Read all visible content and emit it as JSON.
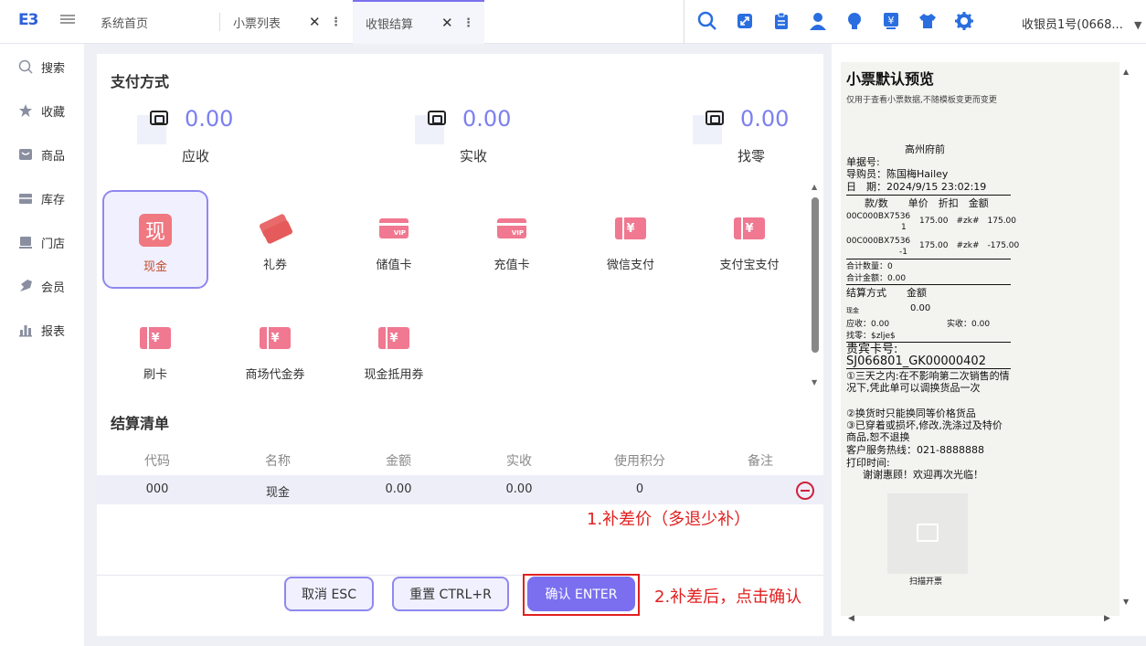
{
  "header": {
    "logo": "E3",
    "tabs": [
      {
        "label": "系统首页"
      },
      {
        "label": "小票列表",
        "close": "✕",
        "more": "⋮"
      },
      {
        "label": "收银结算",
        "close": "✕",
        "more": "⋮"
      }
    ],
    "toolbar_icons": [
      "search-icon",
      "expand-icon",
      "clipboard-icon",
      "user-icon",
      "lightbulb-icon",
      "yen-board-icon",
      "shirt-icon",
      "gear-icon"
    ],
    "user": "收银员1号(0668...",
    "user_arrow": "▼"
  },
  "sidebar": {
    "items": [
      {
        "label": "搜索",
        "icon": "search-icon"
      },
      {
        "label": "收藏",
        "icon": "star-icon"
      },
      {
        "label": "商品",
        "icon": "goods-icon"
      },
      {
        "label": "库存",
        "icon": "inventory-icon"
      },
      {
        "label": "门店",
        "icon": "store-icon"
      },
      {
        "label": "会员",
        "icon": "member-icon"
      },
      {
        "label": "报表",
        "icon": "report-icon"
      }
    ]
  },
  "payment": {
    "title": "支付方式",
    "summary": [
      {
        "value": "0.00",
        "label": "应收"
      },
      {
        "value": "0.00",
        "label": "实收"
      },
      {
        "value": "0.00",
        "label": "找零"
      }
    ],
    "methods": [
      {
        "label": "现金",
        "icon": "cash-icon",
        "glyph": "现",
        "selected": true
      },
      {
        "label": "礼券",
        "icon": "gift-voucher-icon"
      },
      {
        "label": "储值卡",
        "icon": "stored-value-card-icon"
      },
      {
        "label": "充值卡",
        "icon": "recharge-card-icon"
      },
      {
        "label": "微信支付",
        "icon": "wechat-pay-icon"
      },
      {
        "label": "支付宝支付",
        "icon": "alipay-icon"
      },
      {
        "label": "刷卡",
        "icon": "swipe-card-icon"
      },
      {
        "label": "商场代金券",
        "icon": "mall-voucher-icon"
      },
      {
        "label": "现金抵用券",
        "icon": "cash-voucher-icon"
      }
    ],
    "ticket_glyph": "¥"
  },
  "settlement": {
    "title": "结算清单",
    "columns": [
      "代码",
      "名称",
      "金额",
      "实收",
      "使用积分",
      "备注"
    ],
    "rows": [
      {
        "code": "000",
        "name": "现金",
        "amount": "0.00",
        "received": "0.00",
        "points": "0",
        "note": ""
      }
    ]
  },
  "annotations": {
    "note1": "1.补差价（多退少补）",
    "note2": "2.补差后，点击确认"
  },
  "buttons": {
    "cancel": "取消 ESC",
    "reset": "重置 CTRL+R",
    "confirm": "确认 ENTER"
  },
  "receipt": {
    "title": "小票默认预览",
    "subtitle": "仅用于查看小票数据,不随模板变更而变更",
    "store": "高州府前",
    "doc_no": "单据号:",
    "guide": "导购员：陈国梅Hailey",
    "date": "日　期：2024/9/15 23:02:19",
    "item_header": "款/数　　单价　折扣　金额",
    "item1_code": "00C000BX7536",
    "item1_line": "175.00　#zk#　175.00",
    "item1_qty": "1",
    "item2_code": "00C000BX7536",
    "item2_line": "175.00　#zk#　-175.00",
    "item2_qty": "-1",
    "total_qty": "合计数量：0",
    "total_amount": "合计金额：0.00",
    "settle_header": "结算方式　　金额",
    "settle_method": "现金",
    "settle_amount": "0.00",
    "receivable": "应收：0.00",
    "received": "实收：0.00",
    "change": "找零：$zlje$",
    "vip_label": "贵宾卡号:",
    "vip_no": "SJ066801_GK00000402",
    "rule1": "①三天之内:在不影响第二次销售的情况下,凭此单可以调换货品一次",
    "rule2": "②换货时只能换同等价格货品",
    "rule3": "③已穿着或损坏,修改,洗涤过及特价商品,恕不退换",
    "hotline": "客户服务热线：021-8888888",
    "print_time": "打印时间:",
    "thanks": "谢谢惠顾！欢迎再次光临！",
    "qr_label": "扫描开票"
  },
  "colors": {
    "accent": "#7b6ff0",
    "amount": "#7b7ff0",
    "icon_pink": "#f07890",
    "annotation": "#e12020",
    "toolbar_blue": "#2a6ee0"
  }
}
